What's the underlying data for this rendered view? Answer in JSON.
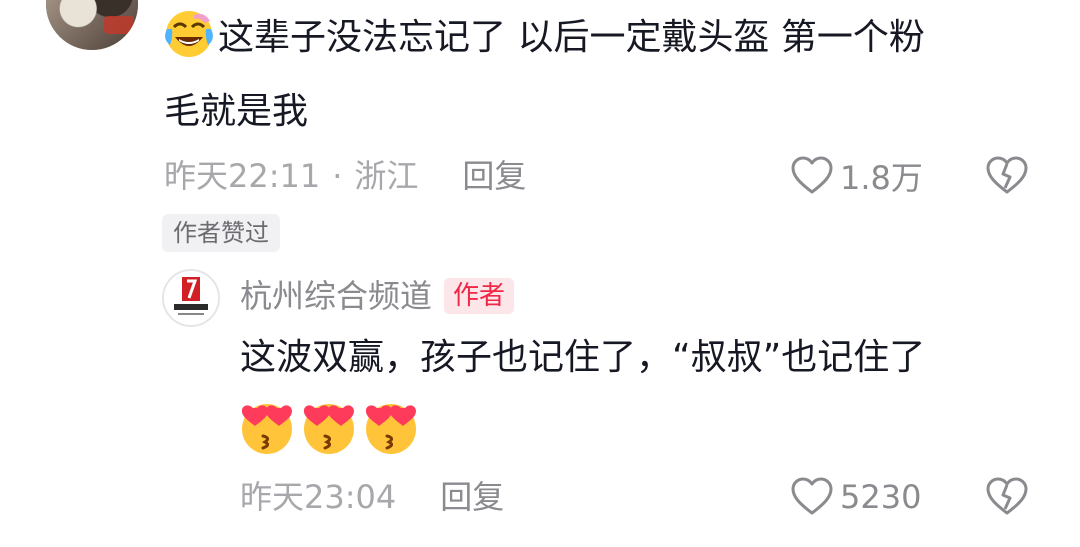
{
  "comment": {
    "line1": "这辈子没法忘记了 以后一定戴头盔 第一个粉",
    "line2": "毛就是我",
    "time": "昨天22:11",
    "separator": "·",
    "location": "浙江",
    "reply_label": "回复",
    "likes": "1.8万",
    "author_liked_badge": "作者赞过",
    "emoji_prefix": "laughing-crying-emoji"
  },
  "reply": {
    "author": "杭州综合频道",
    "author_tag": "作者",
    "avatar_text": "杭州电视台",
    "text": "这波双赢，孩子也记住了，“叔叔”也记住了",
    "emojis": [
      "heart-eyes-kiss-emoji",
      "heart-eyes-kiss-emoji",
      "heart-eyes-kiss-emoji"
    ],
    "time": "昨天23:04",
    "reply_label": "回复",
    "likes": "5230"
  },
  "colors": {
    "text_primary": "#161823",
    "text_muted": "#a8a8ac",
    "author_tag_bg": "#fde6e9",
    "author_tag_fg": "#f02848",
    "badge_bg": "#f1f1f3"
  }
}
